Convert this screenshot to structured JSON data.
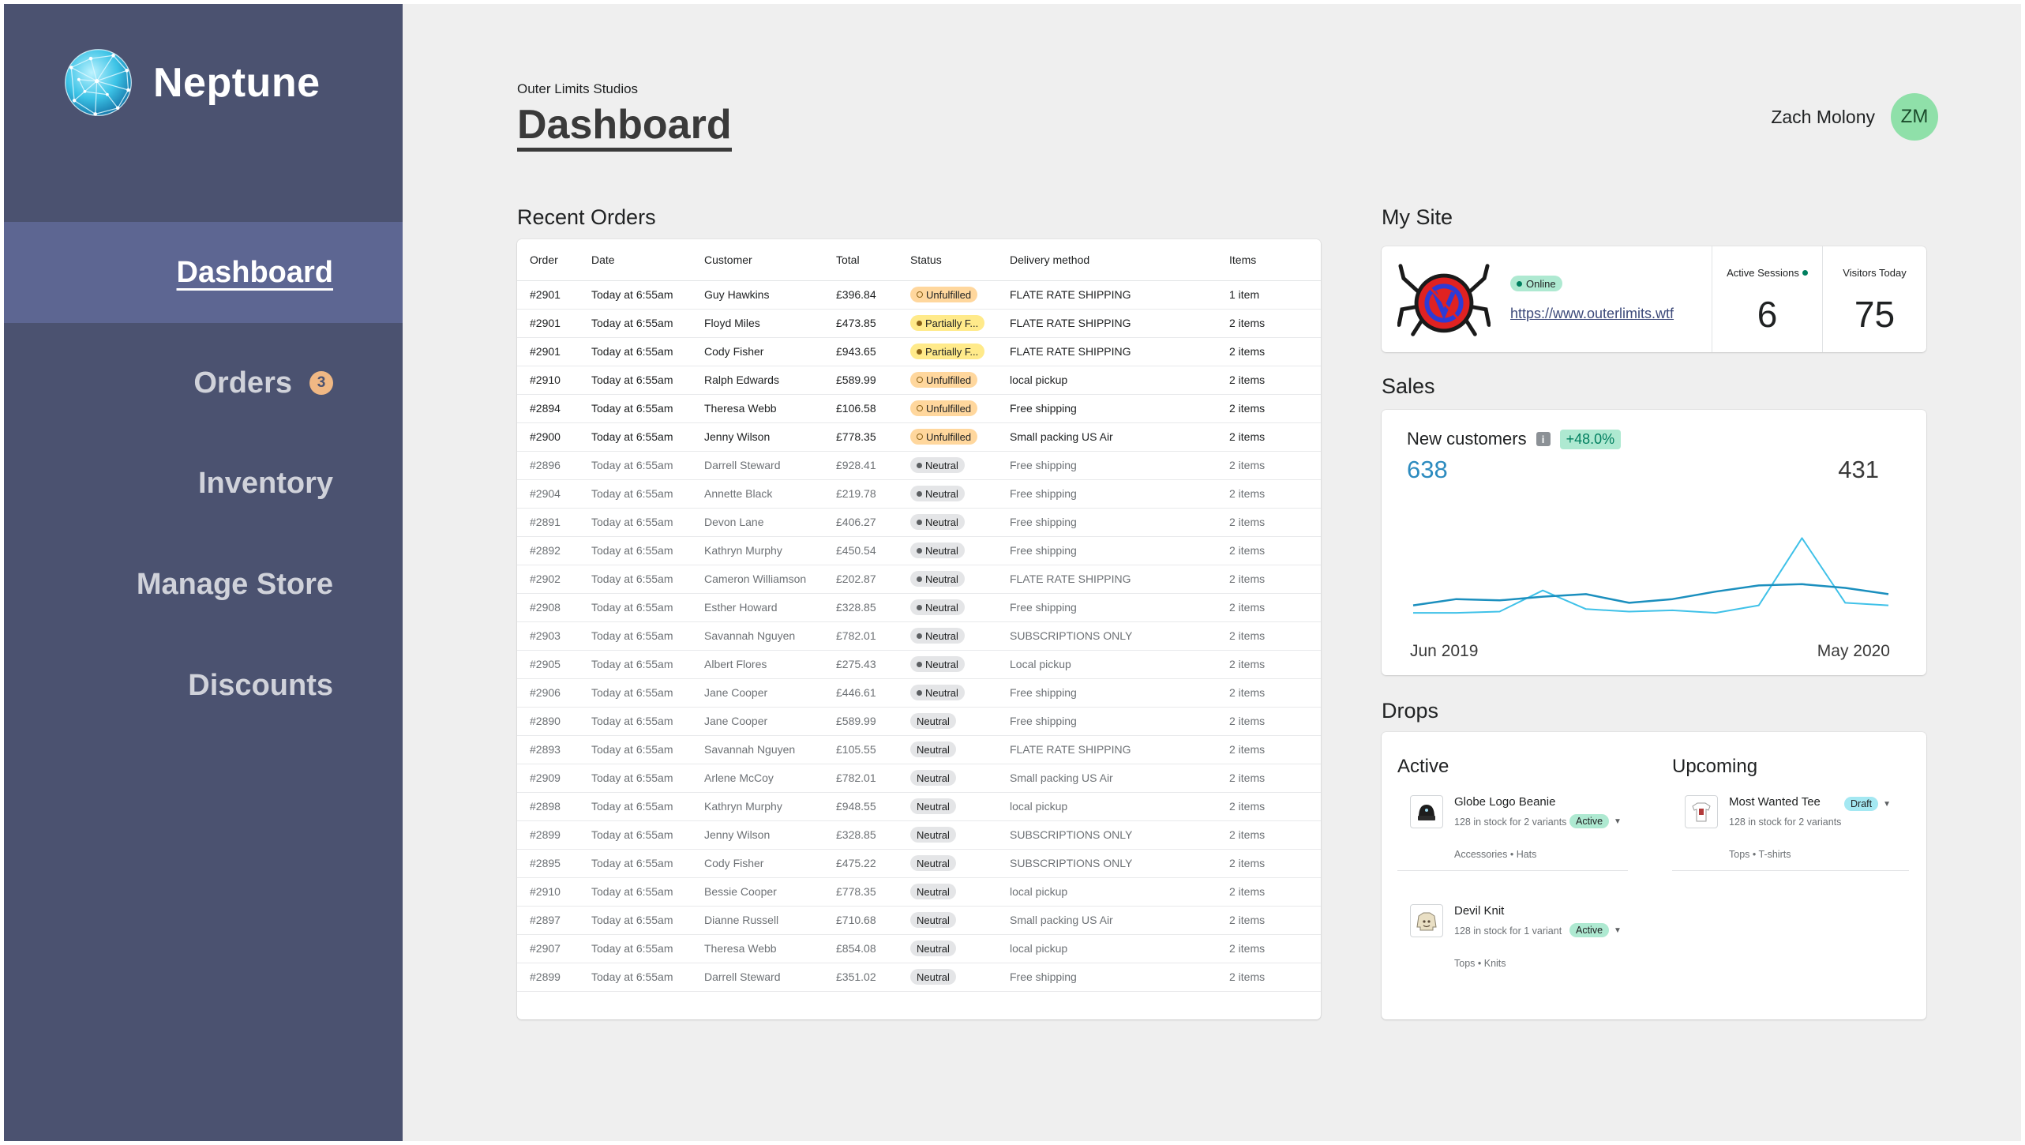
{
  "brand": {
    "name": "Neptune"
  },
  "sidebar": {
    "items": [
      {
        "label": "Dashboard",
        "active": true
      },
      {
        "label": "Orders",
        "badge": "3"
      },
      {
        "label": "Inventory"
      },
      {
        "label": "Manage Store"
      },
      {
        "label": "Discounts"
      }
    ]
  },
  "header": {
    "org": "Outer Limits Studios",
    "title": "Dashboard"
  },
  "user": {
    "name": "Zach Molony",
    "initials": "ZM"
  },
  "orders": {
    "section_title": "Recent Orders",
    "columns": [
      "Order",
      "Date",
      "Customer",
      "Total",
      "Status",
      "Delivery method",
      "Items"
    ],
    "rows": [
      {
        "order": "#2901",
        "date": "Today at 6:55am",
        "customer": "Guy Hawkins",
        "total": "£396.84",
        "status": "Unfulfilled",
        "status_type": "unfulfilled",
        "delivery": "FLATE RATE SHIPPING",
        "items": "1 item",
        "dark": true
      },
      {
        "order": "#2901",
        "date": "Today at 6:55am",
        "customer": "Floyd Miles",
        "total": "£473.85",
        "status": "Partially F...",
        "status_type": "partial",
        "delivery": "FLATE RATE SHIPPING",
        "items": "2 items",
        "dark": true
      },
      {
        "order": "#2901",
        "date": "Today at 6:55am",
        "customer": "Cody Fisher",
        "total": "£943.65",
        "status": "Partially F...",
        "status_type": "partial",
        "delivery": "FLATE RATE SHIPPING",
        "items": "2 items",
        "dark": true
      },
      {
        "order": "#2910",
        "date": "Today at 6:55am",
        "customer": "Ralph Edwards",
        "total": "£589.99",
        "status": "Unfulfilled",
        "status_type": "unfulfilled",
        "delivery": "local pickup",
        "items": "2 items",
        "dark": true
      },
      {
        "order": "#2894",
        "date": "Today at 6:55am",
        "customer": "Theresa Webb",
        "total": "£106.58",
        "status": "Unfulfilled",
        "status_type": "unfulfilled",
        "delivery": "Free shipping",
        "items": "2 items",
        "dark": true
      },
      {
        "order": "#2900",
        "date": "Today at 6:55am",
        "customer": "Jenny Wilson",
        "total": "£778.35",
        "status": "Unfulfilled",
        "status_type": "unfulfilled",
        "delivery": "Small packing US Air",
        "items": "2 items",
        "dark": true
      },
      {
        "order": "#2896",
        "date": "Today at 6:55am",
        "customer": "Darrell Steward",
        "total": "£928.41",
        "status": "Neutral",
        "status_type": "neutral-dot",
        "delivery": "Free shipping",
        "items": "2 items"
      },
      {
        "order": "#2904",
        "date": "Today at 6:55am",
        "customer": "Annette Black",
        "total": "£219.78",
        "status": "Neutral",
        "status_type": "neutral-dot",
        "delivery": "Free shipping",
        "items": "2 items"
      },
      {
        "order": "#2891",
        "date": "Today at 6:55am",
        "customer": "Devon Lane",
        "total": "£406.27",
        "status": "Neutral",
        "status_type": "neutral-dot",
        "delivery": "Free shipping",
        "items": "2 items"
      },
      {
        "order": "#2892",
        "date": "Today at 6:55am",
        "customer": "Kathryn Murphy",
        "total": "£450.54",
        "status": "Neutral",
        "status_type": "neutral-dot",
        "delivery": "Free shipping",
        "items": "2 items"
      },
      {
        "order": "#2902",
        "date": "Today at 6:55am",
        "customer": "Cameron Williamson",
        "total": "£202.87",
        "status": "Neutral",
        "status_type": "neutral-dot",
        "delivery": "FLATE RATE SHIPPING",
        "items": "2 items"
      },
      {
        "order": "#2908",
        "date": "Today at 6:55am",
        "customer": "Esther Howard",
        "total": "£328.85",
        "status": "Neutral",
        "status_type": "neutral-dot",
        "delivery": "Free shipping",
        "items": "2 items"
      },
      {
        "order": "#2903",
        "date": "Today at 6:55am",
        "customer": "Savannah Nguyen",
        "total": "£782.01",
        "status": "Neutral",
        "status_type": "neutral-dot",
        "delivery": "SUBSCRIPTIONS ONLY",
        "items": "2 items"
      },
      {
        "order": "#2905",
        "date": "Today at 6:55am",
        "customer": "Albert Flores",
        "total": "£275.43",
        "status": "Neutral",
        "status_type": "neutral-dot",
        "delivery": "Local pickup",
        "items": "2 items"
      },
      {
        "order": "#2906",
        "date": "Today at 6:55am",
        "customer": "Jane Cooper",
        "total": "£446.61",
        "status": "Neutral",
        "status_type": "neutral-dot",
        "delivery": "Free shipping",
        "items": "2 items"
      },
      {
        "order": "#2890",
        "date": "Today at 6:55am",
        "customer": "Jane Cooper",
        "total": "£589.99",
        "status": "Neutral",
        "status_type": "neutral",
        "delivery": "Free shipping",
        "items": "2 items"
      },
      {
        "order": "#2893",
        "date": "Today at 6:55am",
        "customer": "Savannah Nguyen",
        "total": "£105.55",
        "status": "Neutral",
        "status_type": "neutral",
        "delivery": "FLATE RATE SHIPPING",
        "items": "2 items"
      },
      {
        "order": "#2909",
        "date": "Today at 6:55am",
        "customer": "Arlene McCoy",
        "total": "£782.01",
        "status": "Neutral",
        "status_type": "neutral",
        "delivery": "Small packing US Air",
        "items": "2 items"
      },
      {
        "order": "#2898",
        "date": "Today at 6:55am",
        "customer": "Kathryn Murphy",
        "total": "£948.55",
        "status": "Neutral",
        "status_type": "neutral",
        "delivery": "local pickup",
        "items": "2 items"
      },
      {
        "order": "#2899",
        "date": "Today at 6:55am",
        "customer": "Jenny Wilson",
        "total": "£328.85",
        "status": "Neutral",
        "status_type": "neutral",
        "delivery": "SUBSCRIPTIONS ONLY",
        "items": "2 items"
      },
      {
        "order": "#2895",
        "date": "Today at 6:55am",
        "customer": "Cody Fisher",
        "total": "£475.22",
        "status": "Neutral",
        "status_type": "neutral",
        "delivery": "SUBSCRIPTIONS ONLY",
        "items": "2 items"
      },
      {
        "order": "#2910",
        "date": "Today at 6:55am",
        "customer": "Bessie Cooper",
        "total": "£778.35",
        "status": "Neutral",
        "status_type": "neutral",
        "delivery": "local pickup",
        "items": "2 items"
      },
      {
        "order": "#2897",
        "date": "Today at 6:55am",
        "customer": "Dianne Russell",
        "total": "£710.68",
        "status": "Neutral",
        "status_type": "neutral",
        "delivery": "Small packing US Air",
        "items": "2 items"
      },
      {
        "order": "#2907",
        "date": "Today at 6:55am",
        "customer": "Theresa Webb",
        "total": "£854.08",
        "status": "Neutral",
        "status_type": "neutral",
        "delivery": "local pickup",
        "items": "2 items"
      },
      {
        "order": "#2899",
        "date": "Today at 6:55am",
        "customer": "Darrell Steward",
        "total": "£351.02",
        "status": "Neutral",
        "status_type": "neutral",
        "delivery": "Free shipping",
        "items": "2 items"
      }
    ]
  },
  "site": {
    "section_title": "My Site",
    "status": "Online",
    "url": "https://www.outerlimits.wtf",
    "active_sessions_label": "Active Sessions",
    "active_sessions": "6",
    "visitors_label": "Visitors Today",
    "visitors": "75"
  },
  "sales": {
    "section_title": "Sales",
    "metric_title": "New customers",
    "growth": "+48.0%",
    "current": "638",
    "previous": "431",
    "x_start": "Jun 2019",
    "x_end": "May 2020",
    "colors": {
      "current": "#3fc1e8",
      "previous": "#1b8fbe"
    }
  },
  "chart_data": {
    "type": "line",
    "x": [
      "Jun 2019",
      "",
      "",
      "",
      "",
      "",
      "",
      "",
      "",
      "",
      "",
      "May 2020"
    ],
    "series": [
      {
        "values": [
          12,
          12,
          13,
          30,
          15,
          13,
          14,
          12,
          18,
          72,
          20,
          18
        ]
      },
      {
        "values": [
          18,
          23,
          22,
          25,
          27,
          20,
          23,
          29,
          34,
          35,
          32,
          27
        ]
      }
    ],
    "xlabel": "",
    "ylabel": "",
    "grid": false,
    "ylim": [
      0,
      90
    ]
  },
  "drops": {
    "section_title": "Drops",
    "active_title": "Active",
    "upcoming_title": "Upcoming",
    "active": [
      {
        "name": "Globe Logo Beanie",
        "stock": "128 in stock for 2 variants",
        "tags": "Accessories • Hats",
        "status": "Active"
      },
      {
        "name": "Devil Knit",
        "stock": "128 in stock for 1 variant",
        "tags": "Tops • Knits",
        "status": "Active"
      }
    ],
    "upcoming": [
      {
        "name": "Most Wanted Tee",
        "stock": "128 in stock for 2 variants",
        "tags": "Tops • T-shirts",
        "status": "Draft"
      }
    ]
  }
}
